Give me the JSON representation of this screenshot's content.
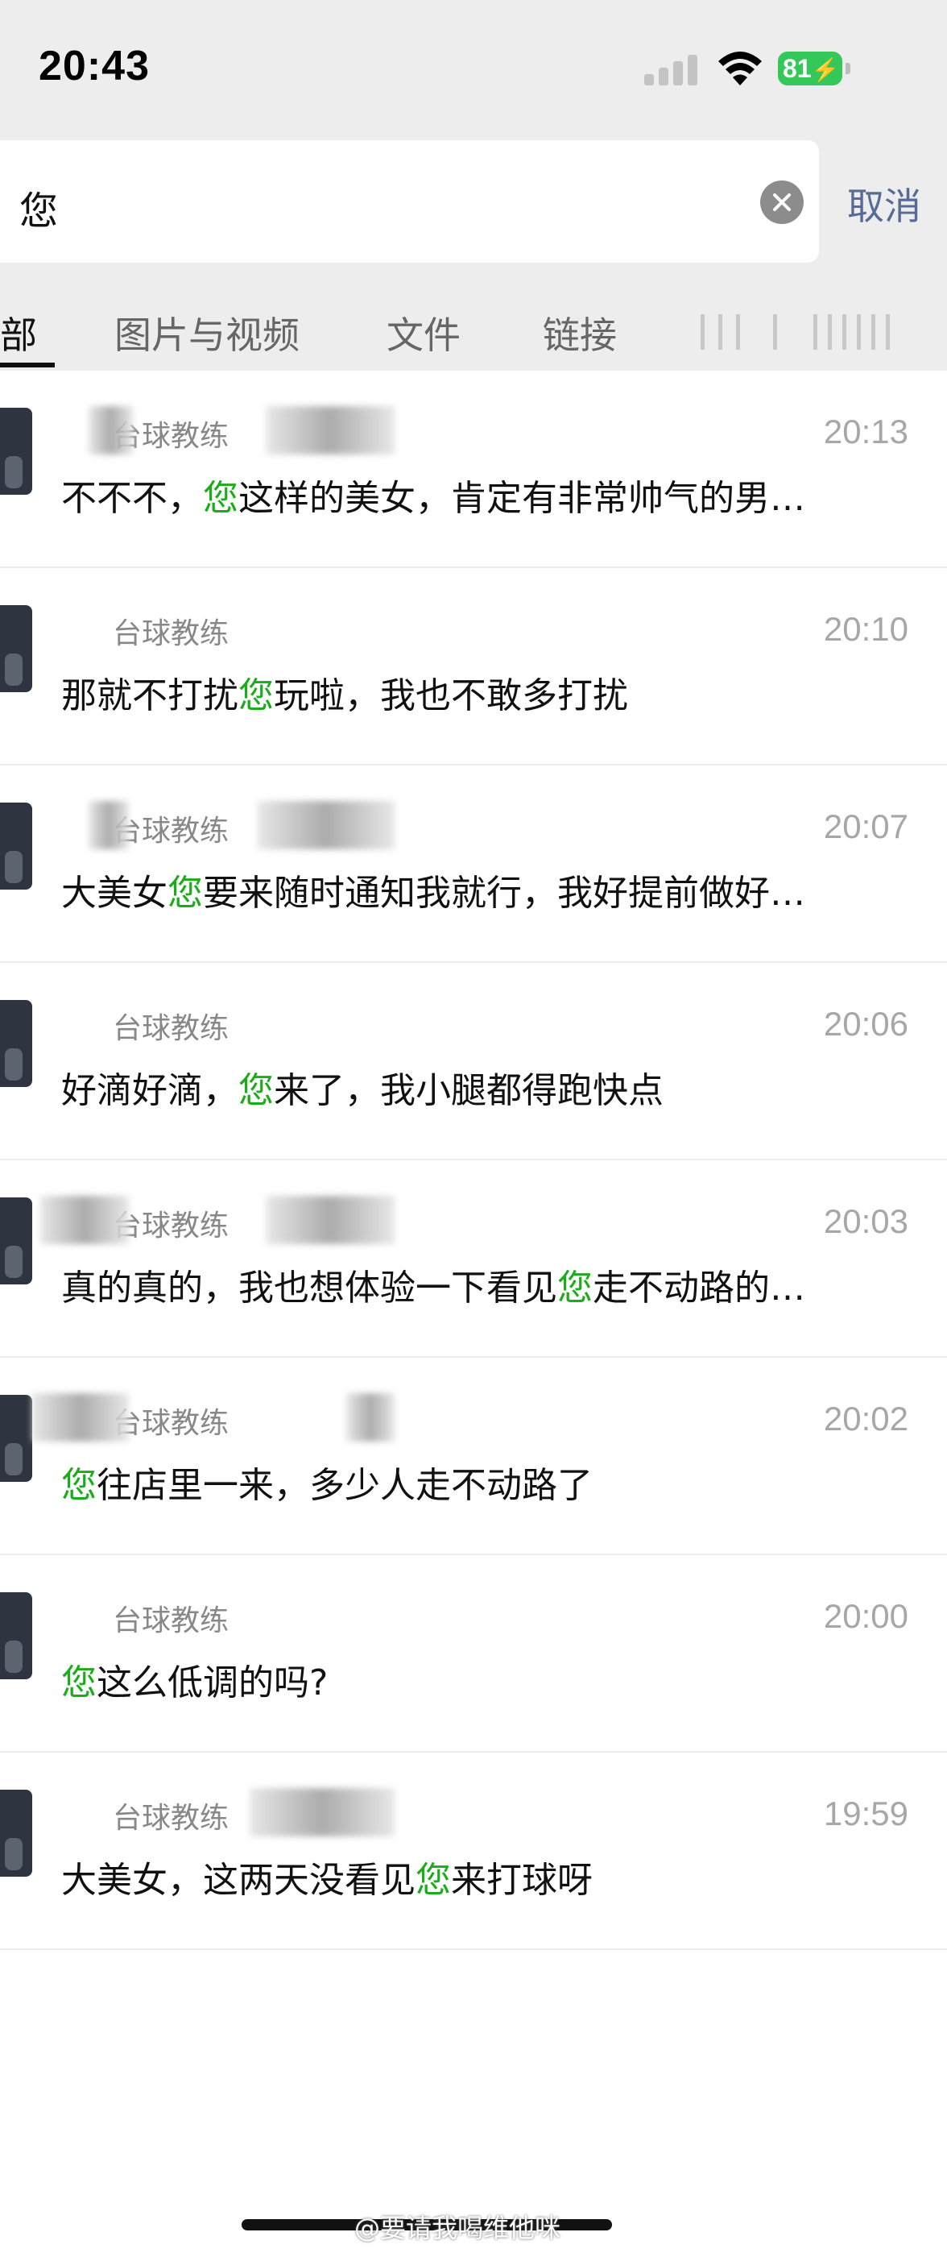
{
  "status_bar": {
    "time": "20:43",
    "battery": "81"
  },
  "search": {
    "query": "您",
    "cancel_label": "取消"
  },
  "tabs": [
    {
      "label": "部",
      "active": true
    },
    {
      "label": "图片与视频"
    },
    {
      "label": "文件"
    },
    {
      "label": "链接"
    }
  ],
  "results": [
    {
      "name": "台球教练",
      "time": "20:13",
      "before": "不不不，",
      "hit": "您",
      "after": "这样的美女，肯定有非常帅气的男…"
    },
    {
      "name": "台球教练",
      "time": "20:10",
      "before": "那就不打扰",
      "hit": "您",
      "after": "玩啦，我也不敢多打扰"
    },
    {
      "name": "台球教练",
      "time": "20:07",
      "before": "大美女",
      "hit": "您",
      "after": "要来随时通知我就行，我好提前做好…"
    },
    {
      "name": "台球教练",
      "time": "20:06",
      "before": "好滴好滴，",
      "hit": "您",
      "after": "来了，我小腿都得跑快点"
    },
    {
      "name": "台球教练",
      "time": "20:03",
      "before": "真的真的，我也想体验一下看见",
      "hit": "您",
      "after": "走不动路的…"
    },
    {
      "name": "台球教练",
      "time": "20:02",
      "before": "",
      "hit": "您",
      "after": "往店里一来，多少人走不动路了"
    },
    {
      "name": "台球教练",
      "time": "20:00",
      "before": "",
      "hit": "您",
      "after": "这么低调的吗?"
    },
    {
      "name": "台球教练",
      "time": "19:59",
      "before": "大美女，这两天没看见",
      "hit": "您",
      "after": "来打球呀"
    }
  ],
  "watermark": "@要请我喝维他咪"
}
